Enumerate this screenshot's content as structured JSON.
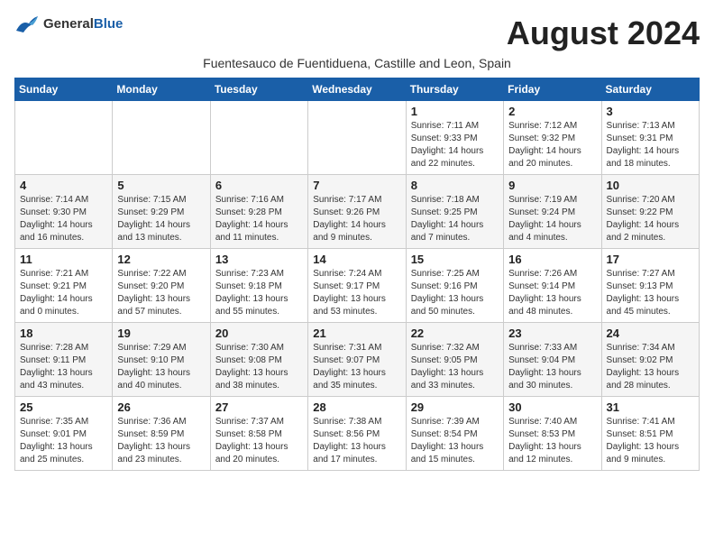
{
  "header": {
    "logo_general": "General",
    "logo_blue": "Blue",
    "month_title": "August 2024",
    "subtitle": "Fuentesauco de Fuentiduena, Castille and Leon, Spain"
  },
  "weekdays": [
    "Sunday",
    "Monday",
    "Tuesday",
    "Wednesday",
    "Thursday",
    "Friday",
    "Saturday"
  ],
  "weeks": [
    [
      {
        "day": "",
        "info": ""
      },
      {
        "day": "",
        "info": ""
      },
      {
        "day": "",
        "info": ""
      },
      {
        "day": "",
        "info": ""
      },
      {
        "day": "1",
        "info": "Sunrise: 7:11 AM\nSunset: 9:33 PM\nDaylight: 14 hours\nand 22 minutes."
      },
      {
        "day": "2",
        "info": "Sunrise: 7:12 AM\nSunset: 9:32 PM\nDaylight: 14 hours\nand 20 minutes."
      },
      {
        "day": "3",
        "info": "Sunrise: 7:13 AM\nSunset: 9:31 PM\nDaylight: 14 hours\nand 18 minutes."
      }
    ],
    [
      {
        "day": "4",
        "info": "Sunrise: 7:14 AM\nSunset: 9:30 PM\nDaylight: 14 hours\nand 16 minutes."
      },
      {
        "day": "5",
        "info": "Sunrise: 7:15 AM\nSunset: 9:29 PM\nDaylight: 14 hours\nand 13 minutes."
      },
      {
        "day": "6",
        "info": "Sunrise: 7:16 AM\nSunset: 9:28 PM\nDaylight: 14 hours\nand 11 minutes."
      },
      {
        "day": "7",
        "info": "Sunrise: 7:17 AM\nSunset: 9:26 PM\nDaylight: 14 hours\nand 9 minutes."
      },
      {
        "day": "8",
        "info": "Sunrise: 7:18 AM\nSunset: 9:25 PM\nDaylight: 14 hours\nand 7 minutes."
      },
      {
        "day": "9",
        "info": "Sunrise: 7:19 AM\nSunset: 9:24 PM\nDaylight: 14 hours\nand 4 minutes."
      },
      {
        "day": "10",
        "info": "Sunrise: 7:20 AM\nSunset: 9:22 PM\nDaylight: 14 hours\nand 2 minutes."
      }
    ],
    [
      {
        "day": "11",
        "info": "Sunrise: 7:21 AM\nSunset: 9:21 PM\nDaylight: 14 hours\nand 0 minutes."
      },
      {
        "day": "12",
        "info": "Sunrise: 7:22 AM\nSunset: 9:20 PM\nDaylight: 13 hours\nand 57 minutes."
      },
      {
        "day": "13",
        "info": "Sunrise: 7:23 AM\nSunset: 9:18 PM\nDaylight: 13 hours\nand 55 minutes."
      },
      {
        "day": "14",
        "info": "Sunrise: 7:24 AM\nSunset: 9:17 PM\nDaylight: 13 hours\nand 53 minutes."
      },
      {
        "day": "15",
        "info": "Sunrise: 7:25 AM\nSunset: 9:16 PM\nDaylight: 13 hours\nand 50 minutes."
      },
      {
        "day": "16",
        "info": "Sunrise: 7:26 AM\nSunset: 9:14 PM\nDaylight: 13 hours\nand 48 minutes."
      },
      {
        "day": "17",
        "info": "Sunrise: 7:27 AM\nSunset: 9:13 PM\nDaylight: 13 hours\nand 45 minutes."
      }
    ],
    [
      {
        "day": "18",
        "info": "Sunrise: 7:28 AM\nSunset: 9:11 PM\nDaylight: 13 hours\nand 43 minutes."
      },
      {
        "day": "19",
        "info": "Sunrise: 7:29 AM\nSunset: 9:10 PM\nDaylight: 13 hours\nand 40 minutes."
      },
      {
        "day": "20",
        "info": "Sunrise: 7:30 AM\nSunset: 9:08 PM\nDaylight: 13 hours\nand 38 minutes."
      },
      {
        "day": "21",
        "info": "Sunrise: 7:31 AM\nSunset: 9:07 PM\nDaylight: 13 hours\nand 35 minutes."
      },
      {
        "day": "22",
        "info": "Sunrise: 7:32 AM\nSunset: 9:05 PM\nDaylight: 13 hours\nand 33 minutes."
      },
      {
        "day": "23",
        "info": "Sunrise: 7:33 AM\nSunset: 9:04 PM\nDaylight: 13 hours\nand 30 minutes."
      },
      {
        "day": "24",
        "info": "Sunrise: 7:34 AM\nSunset: 9:02 PM\nDaylight: 13 hours\nand 28 minutes."
      }
    ],
    [
      {
        "day": "25",
        "info": "Sunrise: 7:35 AM\nSunset: 9:01 PM\nDaylight: 13 hours\nand 25 minutes."
      },
      {
        "day": "26",
        "info": "Sunrise: 7:36 AM\nSunset: 8:59 PM\nDaylight: 13 hours\nand 23 minutes."
      },
      {
        "day": "27",
        "info": "Sunrise: 7:37 AM\nSunset: 8:58 PM\nDaylight: 13 hours\nand 20 minutes."
      },
      {
        "day": "28",
        "info": "Sunrise: 7:38 AM\nSunset: 8:56 PM\nDaylight: 13 hours\nand 17 minutes."
      },
      {
        "day": "29",
        "info": "Sunrise: 7:39 AM\nSunset: 8:54 PM\nDaylight: 13 hours\nand 15 minutes."
      },
      {
        "day": "30",
        "info": "Sunrise: 7:40 AM\nSunset: 8:53 PM\nDaylight: 13 hours\nand 12 minutes."
      },
      {
        "day": "31",
        "info": "Sunrise: 7:41 AM\nSunset: 8:51 PM\nDaylight: 13 hours\nand 9 minutes."
      }
    ]
  ]
}
